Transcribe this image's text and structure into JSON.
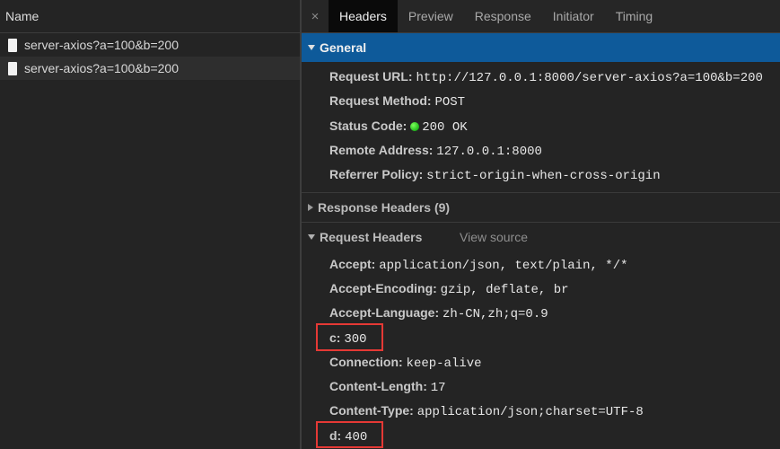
{
  "left": {
    "header": "Name",
    "requests": [
      {
        "name": "server-axios?a=100&b=200"
      },
      {
        "name": "server-axios?a=100&b=200"
      }
    ]
  },
  "tabs": {
    "close": "×",
    "items": [
      {
        "label": "Headers",
        "active": true
      },
      {
        "label": "Preview"
      },
      {
        "label": "Response"
      },
      {
        "label": "Initiator"
      },
      {
        "label": "Timing"
      }
    ]
  },
  "general": {
    "title": "General",
    "request_url_key": "Request URL:",
    "request_url": "http://127.0.0.1:8000/server-axios?a=100&b=200",
    "request_method_key": "Request Method:",
    "request_method": "POST",
    "status_code_key": "Status Code:",
    "status_code": "200 OK",
    "remote_address_key": "Remote Address:",
    "remote_address": "127.0.0.1:8000",
    "referrer_policy_key": "Referrer Policy:",
    "referrer_policy": "strict-origin-when-cross-origin"
  },
  "response_headers": {
    "title": "Response Headers (9)"
  },
  "request_headers": {
    "title": "Request Headers",
    "view_source": "View source",
    "accept_key": "Accept:",
    "accept": "application/json, text/plain, */*",
    "accept_encoding_key": "Accept-Encoding:",
    "accept_encoding": "gzip, deflate, br",
    "accept_language_key": "Accept-Language:",
    "accept_language": "zh-CN,zh;q=0.9",
    "c_key": "c:",
    "c": "300",
    "connection_key": "Connection:",
    "connection": "keep-alive",
    "content_length_key": "Content-Length:",
    "content_length": "17",
    "content_type_key": "Content-Type:",
    "content_type": "application/json;charset=UTF-8",
    "d_key": "d:",
    "d": "400"
  },
  "colors": {
    "section_bar": "#0e5a9a",
    "highlight": "#e53935",
    "status_ok": "#1fb81a"
  }
}
